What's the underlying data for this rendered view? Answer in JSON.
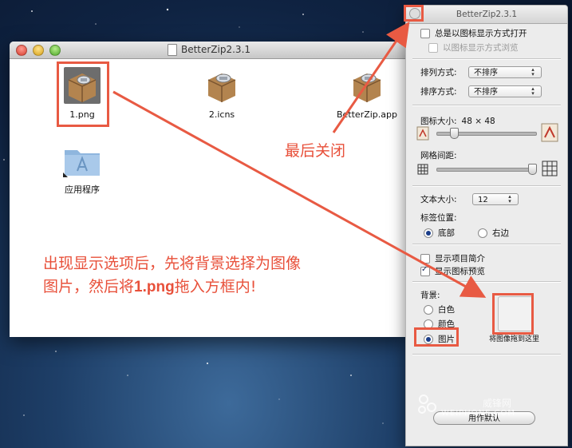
{
  "finder": {
    "title": "BetterZip2.3.1",
    "files": [
      {
        "name": "1.png"
      },
      {
        "name": "2.icns"
      },
      {
        "name": "BetterZip.app"
      },
      {
        "name": "应用程序"
      }
    ]
  },
  "panel": {
    "title": "BetterZip2.3.1",
    "always_open_icon_view": "总是以图标显示方式打开",
    "browse_icon_view": "以图标显示方式浏览",
    "arrange_by_label": "排列方式:",
    "arrange_by_value": "不排序",
    "sort_by_label": "排序方式:",
    "sort_by_value": "不排序",
    "icon_size_label": "图标大小:",
    "icon_size_value": "48 × 48",
    "grid_spacing_label": "网格间距:",
    "text_size_label": "文本大小:",
    "text_size_value": "12",
    "label_position_label": "标签位置:",
    "label_bottom": "底部",
    "label_right": "右边",
    "show_item_info": "显示项目简介",
    "show_icon_preview": "显示图标预览",
    "background_label": "背景:",
    "bg_white": "白色",
    "bg_color": "颜色",
    "bg_picture": "图片",
    "drop_hint": "将图像拖到这里",
    "default_button": "用作默认"
  },
  "annotations": {
    "close_note": "最后关闭",
    "instruction_line1": "出现显示选项后，先将背景选择为图像",
    "instruction_line2_a": "图片，然后将",
    "instruction_line2_b": "1.png",
    "instruction_line2_c": "拖入方框内!",
    "color": "#e8503a"
  },
  "watermark": {
    "text_cn": "威锋网",
    "text_en": "WEIPHONE.COM"
  }
}
